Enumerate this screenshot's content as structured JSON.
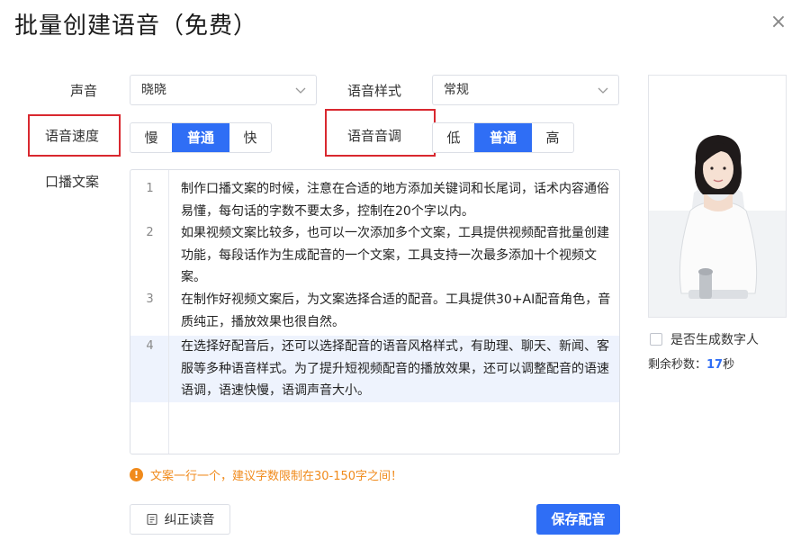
{
  "dialog": {
    "title": "批量创建语音（免费）",
    "close_glyph": "×"
  },
  "voice": {
    "label": "声音",
    "value": "晓晓"
  },
  "style": {
    "label": "语音样式",
    "value": "常规"
  },
  "speed": {
    "label": "语音速度",
    "options": [
      "慢",
      "普通",
      "快"
    ],
    "selected": "普通"
  },
  "pitch": {
    "label": "语音音调",
    "options": [
      "低",
      "普通",
      "高"
    ],
    "selected": "普通"
  },
  "script": {
    "label": "口播文案",
    "lines": [
      {
        "num": "1",
        "text": "制作口播文案的时候，注意在合适的地方添加关键词和长尾词，话术内容通俗易懂，每句话的字数不要太多，控制在20个字以内。"
      },
      {
        "num": "2",
        "text": "如果视频文案比较多，也可以一次添加多个文案，工具提供视频配音批量创建功能，每段话作为生成配音的一个文案，工具支持一次最多添加十个视频文案。"
      },
      {
        "num": "3",
        "text": "在制作好视频文案后，为文案选择合适的配音。工具提供30+AI配音角色，音质纯正，播放效果也很自然。"
      },
      {
        "num": "4",
        "text": "在选择好配音后，还可以选择配音的语音风格样式，有助理、聊天、新闻、客服等多种语音样式。为了提升短视频配音的播放效果，还可以调整配音的语速语调，语速快慢，语调声音大小。"
      }
    ],
    "highlighted_line": "4"
  },
  "warning": {
    "text": "文案一行一个，建议字数限制在30-150字之间！"
  },
  "buttons": {
    "correct": "纠正读音",
    "save": "保存配音"
  },
  "digital_human": {
    "checkbox_label": "是否生成数字人",
    "checked": false,
    "remain_label": "剩余秒数：",
    "remain_value": "17",
    "remain_unit": "秒"
  },
  "icons": {
    "close": "close-icon",
    "chevron": "chevron-down-icon",
    "warning": "warning-icon",
    "correct": "document-icon"
  },
  "colors": {
    "primary": "#2f6ef5",
    "warning": "#f08a1b",
    "annotation": "#d9282f",
    "highlight": "#eef3fd"
  }
}
